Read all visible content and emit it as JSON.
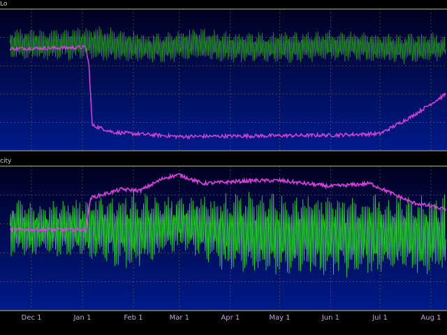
{
  "chart_data": [
    {
      "type": "line",
      "title": "",
      "panel_label": "Lo",
      "xlabel": "",
      "ylabel": "",
      "grid": true,
      "background_colors": [
        "#000020",
        "#001a8a"
      ],
      "series": [
        {
          "color": "#2ca02c",
          "style": "dense-oscillating",
          "keypoints": [
            {
              "x": "Nov 18",
              "lo": 0.62,
              "hi": 0.88
            },
            {
              "x": "Dec 15",
              "lo": 0.62,
              "hi": 0.88
            },
            {
              "x": "Jan 8",
              "lo": 0.62,
              "hi": 0.9
            },
            {
              "x": "Feb 10",
              "lo": 0.6,
              "hi": 0.84
            },
            {
              "x": "Mar 10",
              "lo": 0.62,
              "hi": 0.88
            },
            {
              "x": "Apr 20",
              "lo": 0.6,
              "hi": 0.85
            },
            {
              "x": "Jun 1",
              "lo": 0.62,
              "hi": 0.86
            },
            {
              "x": "Jul 15",
              "lo": 0.6,
              "hi": 0.84
            },
            {
              "x": "Aug 10",
              "lo": 0.62,
              "hi": 0.85
            }
          ]
        },
        {
          "color": "#d040d0",
          "style": "line",
          "keypoints": [
            {
              "x": "Nov 18",
              "y": 0.72
            },
            {
              "x": "Jan 3",
              "y": 0.73
            },
            {
              "x": "Jan 5",
              "y": 0.6
            },
            {
              "x": "Jan 7",
              "y": 0.18
            },
            {
              "x": "Jan 20",
              "y": 0.13
            },
            {
              "x": "Mar 1",
              "y": 0.1
            },
            {
              "x": "Jun 1",
              "y": 0.11
            },
            {
              "x": "Jul 1",
              "y": 0.12
            },
            {
              "x": "Jul 20",
              "y": 0.24
            },
            {
              "x": "Aug 10",
              "y": 0.4
            }
          ]
        }
      ]
    },
    {
      "type": "line",
      "title": "",
      "panel_label": "city",
      "xlabel": "",
      "ylabel": "",
      "grid": true,
      "background_colors": [
        "#000020",
        "#001a8a"
      ],
      "x_tick_labels": [
        "Dec 1",
        "Jan 1",
        "Feb 1",
        "Mar 1",
        "Apr 1",
        "May 1",
        "Jun 1",
        "Jul 1",
        "Aug 1"
      ],
      "series": [
        {
          "color": "#33ee33",
          "style": "dense-oscillating",
          "keypoints": [
            {
              "x": "Nov 18",
              "lo": 0.35,
              "hi": 0.78
            },
            {
              "x": "Jan 1",
              "lo": 0.32,
              "hi": 0.8
            },
            {
              "x": "Feb 1",
              "lo": 0.25,
              "hi": 0.85
            },
            {
              "x": "Mar 1",
              "lo": 0.4,
              "hi": 0.8
            },
            {
              "x": "Apr 1",
              "lo": 0.22,
              "hi": 0.85
            },
            {
              "x": "Jun 1",
              "lo": 0.2,
              "hi": 0.84
            },
            {
              "x": "Aug 10",
              "lo": 0.22,
              "hi": 0.83
            }
          ]
        },
        {
          "color": "#e040e0",
          "style": "line",
          "keypoints": [
            {
              "x": "Nov 18",
              "y": 0.56
            },
            {
              "x": "Jan 3",
              "y": 0.56
            },
            {
              "x": "Jan 6",
              "y": 0.78
            },
            {
              "x": "Jan 25",
              "y": 0.84
            },
            {
              "x": "Feb 5",
              "y": 0.83
            },
            {
              "x": "Feb 20",
              "y": 0.92
            },
            {
              "x": "Mar 1",
              "y": 0.94
            },
            {
              "x": "Mar 15",
              "y": 0.88
            },
            {
              "x": "Apr 15",
              "y": 0.9
            },
            {
              "x": "May 1",
              "y": 0.9
            },
            {
              "x": "Jun 1",
              "y": 0.86
            },
            {
              "x": "Jun 25",
              "y": 0.88
            },
            {
              "x": "Jul 20",
              "y": 0.75
            },
            {
              "x": "Aug 10",
              "y": 0.7
            }
          ]
        }
      ]
    }
  ]
}
